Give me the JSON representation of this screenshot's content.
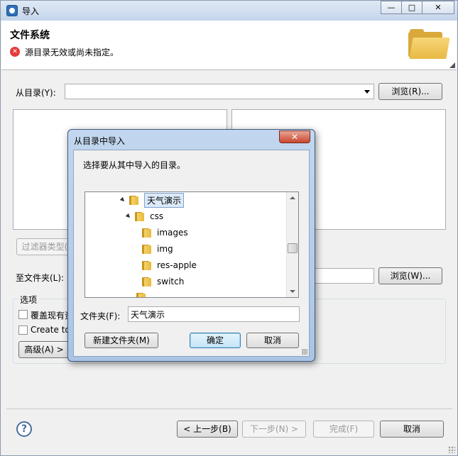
{
  "window": {
    "title": "导入",
    "controls": [
      "—",
      "□",
      "✕"
    ]
  },
  "banner": {
    "title": "文件系统",
    "error_message": "源目录无效或尚未指定。"
  },
  "form": {
    "from_dir_label": "从目录(Y):",
    "from_dir_value": "",
    "browse_label": "浏览(R)...",
    "filter_label": "过滤器类型(",
    "to_folder_label": "至文件夹(L):",
    "browse2_label": "浏览(W)...",
    "options_label": "选项",
    "overwrite_label": "覆盖现有资",
    "create_label": "Create to",
    "advanced_label": "高级(A) >"
  },
  "footer": {
    "help": "?",
    "back_label": "< 上一步(B)",
    "next_label": "下一步(N) >",
    "finish_label": "完成(F)",
    "cancel_label": "取消"
  },
  "dialog": {
    "title": "从目录中导入",
    "close": "✕",
    "prompt": "选择要从其中导入的目录。",
    "tree": [
      {
        "label": "天气演示",
        "selected": true,
        "expanded": true
      },
      {
        "label": "css",
        "expanded": true
      },
      {
        "label": "images"
      },
      {
        "label": "img"
      },
      {
        "label": "res-apple"
      },
      {
        "label": "switch"
      }
    ],
    "folder_label": "文件夹(F):",
    "folder_value": "天气演示",
    "new_folder_label": "新建文件夹(M)",
    "ok_label": "确定",
    "cancel_label": "取消"
  }
}
